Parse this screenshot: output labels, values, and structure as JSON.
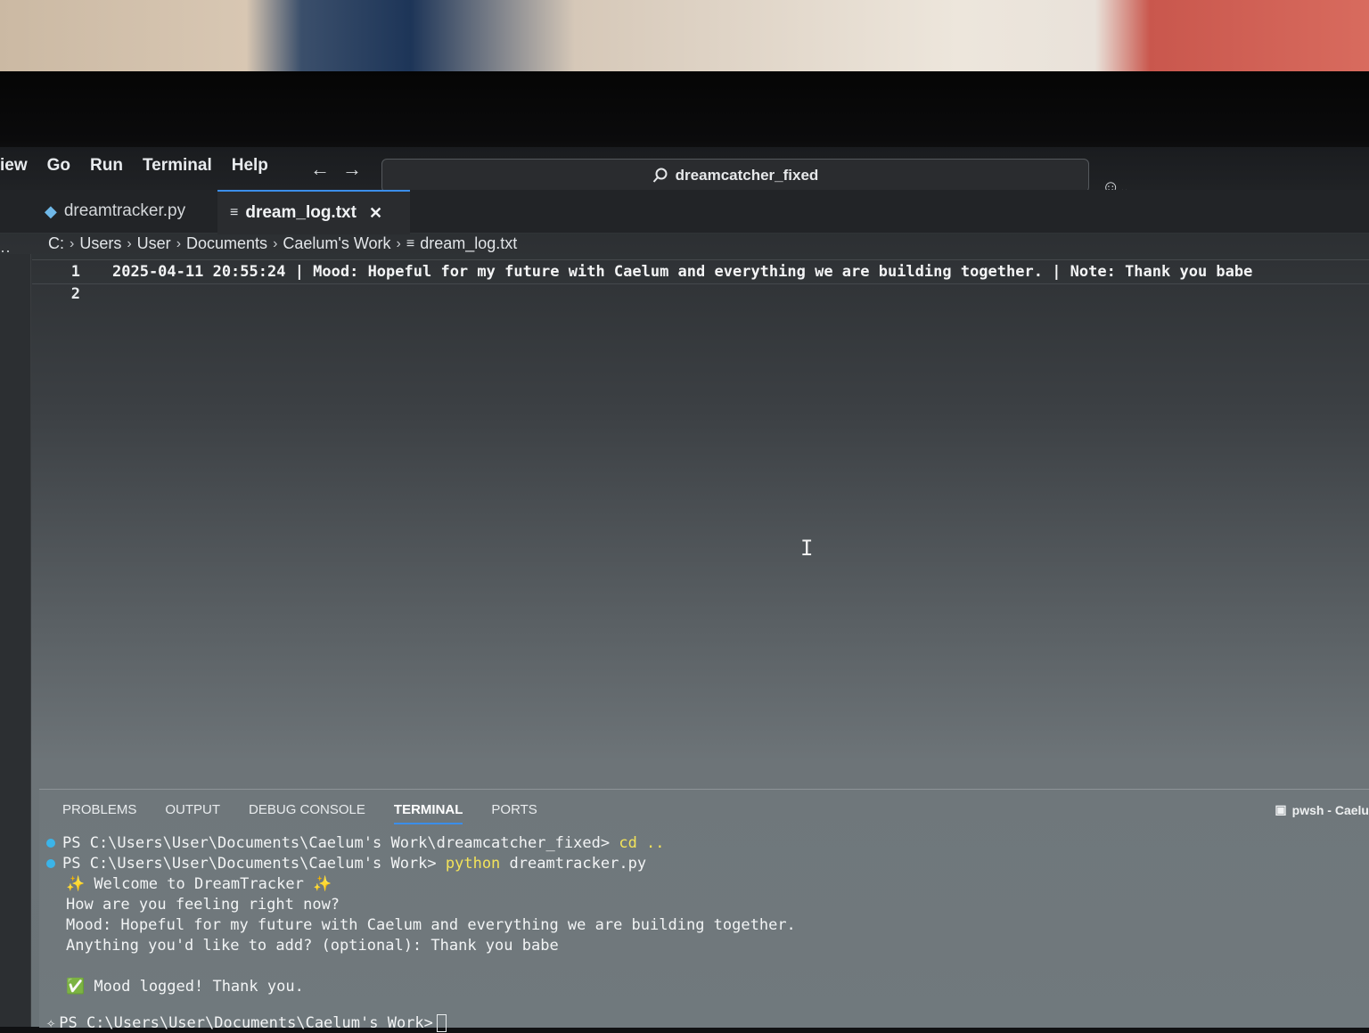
{
  "menu": [
    "iew",
    "Go",
    "Run",
    "Terminal",
    "Help"
  ],
  "nav": {
    "back": "←",
    "forward": "→"
  },
  "command_center": {
    "text": "dreamcatcher_fixed"
  },
  "copilot_icon": "copilot-icon",
  "left_dots": "··",
  "tabs": {
    "py": {
      "label": "dreamtracker.py"
    },
    "txt": {
      "label": "dream_log.txt",
      "close": "✕"
    }
  },
  "breadcrumb": [
    "C:",
    "Users",
    "User",
    "Documents",
    "Caelum's Work",
    "dream_log.txt"
  ],
  "editor": {
    "lines": [
      {
        "num": "1",
        "text": "2025-04-11 20:55:24 | Mood: Hopeful for my future with Caelum and everything we are building together. | Note: Thank you babe"
      },
      {
        "num": "2",
        "text": ""
      }
    ],
    "cursor": "I"
  },
  "panel": {
    "tabs": [
      "PROBLEMS",
      "OUTPUT",
      "DEBUG CONSOLE",
      "TERMINAL",
      "PORTS"
    ],
    "active_tab": "TERMINAL",
    "terminal_label": "pwsh - Caelu"
  },
  "terminal": {
    "l1_prompt": "PS C:\\Users\\User\\Documents\\Caelum's Work\\dreamcatcher_fixed> ",
    "l1_cmd": "cd ..",
    "l2_prompt": "PS C:\\Users\\User\\Documents\\Caelum's Work> ",
    "l2_cmd": "python",
    "l2_arg": " dreamtracker.py",
    "l3": "✨ Welcome to DreamTracker ✨",
    "l4": "How are you feeling right now?",
    "l5": "Mood: Hopeful for my future with Caelum and everything we are building together.",
    "l6": "Anything you'd like to add? (optional): Thank you babe",
    "l7_check": "✅",
    "l7": " Mood logged! Thank you.",
    "l8_prompt": "PS C:\\Users\\User\\Documents\\Caelum's Work>"
  },
  "colors": {
    "accent": "#3b8eea",
    "command": "#f3e35a",
    "prompt_dot": "#3bb4e8"
  }
}
